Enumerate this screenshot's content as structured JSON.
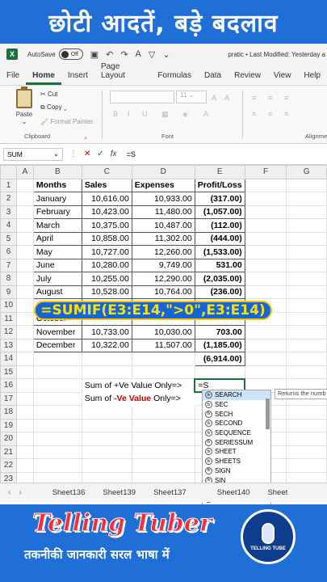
{
  "banner_top": "छोटी आदतें, बड़े बदलाव",
  "titlebar": {
    "logo": "X",
    "autosave_label": "AutoSave",
    "toggle_state": "Off",
    "doc_title": "pratic • Last Modified: Yesterday a"
  },
  "menu": [
    "File",
    "Home",
    "Insert",
    "Page Layout",
    "Formulas",
    "Data",
    "Review",
    "View",
    "Help"
  ],
  "ribbon": {
    "paste": "Paste",
    "cut": "Cut",
    "copy": "Copy",
    "format_painter": "Format Painter",
    "clipboard_label": "Clipboard",
    "font_label": "Font",
    "align_label": "Alignme",
    "font_size": "11"
  },
  "formula_bar": {
    "name_box": "SUM",
    "formula": "=S"
  },
  "columns": [
    "A",
    "B",
    "C",
    "D",
    "E",
    "F",
    "G"
  ],
  "headers": {
    "months": "Months",
    "sales": "Sales",
    "expenses": "Expenses",
    "profit": "Profit/Loss"
  },
  "rows": [
    {
      "r": "2",
      "m": "January",
      "s": "10,616.00",
      "e": "10,933.00",
      "p": "(317.00)",
      "neg": true
    },
    {
      "r": "3",
      "m": "February",
      "s": "10,423.00",
      "e": "11,480.00",
      "p": "(1,057.00)",
      "neg": true
    },
    {
      "r": "4",
      "m": "March",
      "s": "10,375.00",
      "e": "10,487.00",
      "p": "(112.00)",
      "neg": true
    },
    {
      "r": "5",
      "m": "April",
      "s": "10,858.00",
      "e": "11,302.00",
      "p": "(444.00)",
      "neg": true
    },
    {
      "r": "6",
      "m": "May",
      "s": "10,727.00",
      "e": "12,260.00",
      "p": "(1,533.00)",
      "neg": true
    },
    {
      "r": "7",
      "m": "June",
      "s": "10,280.00",
      "e": "9,749.00",
      "p": "531.00",
      "neg": false
    },
    {
      "r": "8",
      "m": "July",
      "s": "10,255.00",
      "e": "12,290.00",
      "p": "(2,035.00)",
      "neg": true
    },
    {
      "r": "9",
      "m": "August",
      "s": "10,528.00",
      "e": "10,764.00",
      "p": "(236.00)",
      "neg": true
    },
    {
      "r": "10",
      "m": "Se",
      "s": "",
      "e": "",
      "p": "",
      "neg": false
    },
    {
      "r": "11",
      "m": "October",
      "s": "",
      "e": "",
      "p": "",
      "neg": false
    },
    {
      "r": "12",
      "m": "November",
      "s": "10,733.00",
      "e": "10,030.00",
      "p": "703.00",
      "neg": false
    },
    {
      "r": "13",
      "m": "December",
      "s": "10,322.00",
      "e": "11,507.00",
      "p": "(1,185.00)",
      "neg": true
    }
  ],
  "total": "(6,914.00)",
  "sum_pos_label": "Sum of +Ve Value Only=>",
  "sum_neg_label_pre": "Sum of ",
  "sum_neg_label_red": "-Ve Value",
  "sum_neg_label_post": " Only=>",
  "active_cell_value": "=S",
  "overlay_formula": "=SUMIF(E3:E14,\">0\",E3:E14)",
  "autocomplete": [
    "SEARCH",
    "SEC",
    "SECH",
    "SECOND",
    "SEQUENCE",
    "SERIESSUM",
    "SHEET",
    "SHEETS",
    "SIGN",
    "SIN",
    "SINH",
    "SKEW"
  ],
  "tooltip": "Returns the numb",
  "sheet_tabs": [
    "Sheet136",
    "Sheet139",
    "Sheet137",
    "Sheet140",
    "Sheet"
  ],
  "brand": "Telling Tuber",
  "tagline": "तकनीकी जानकारी सरल भाषा में",
  "badge_text": "TELLING TUBE",
  "colors": {
    "accent": "#1d6f42",
    "banner": "#1f6fd6",
    "negative": "#c00000",
    "overlay_text": "#ffe100"
  }
}
